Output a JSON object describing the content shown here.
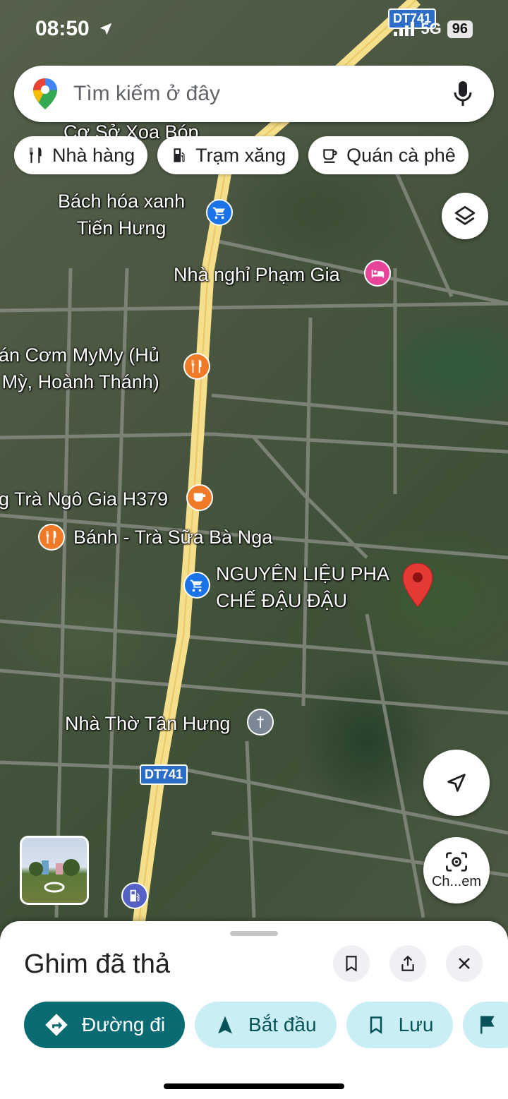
{
  "status_bar": {
    "time": "08:50",
    "network": "5G",
    "battery": "96"
  },
  "search": {
    "placeholder": "Tìm kiếm ở đây"
  },
  "chips": [
    {
      "label": "Nhà hàng",
      "icon": "restaurant-icon"
    },
    {
      "label": "Trạm xăng",
      "icon": "gas-station-icon"
    },
    {
      "label": "Quán cà phê",
      "icon": "coffee-icon"
    }
  ],
  "map": {
    "road_shields": [
      "DT741",
      "DT741"
    ],
    "places": [
      {
        "name": "Cơ Sở Xoa Bóp",
        "icon": "spa-icon"
      },
      {
        "name": "Bách hóa xanh\nTiến Hưng",
        "icon": "shopping-cart-icon",
        "color": "#1a73e8"
      },
      {
        "name": "Nhà nghỉ Phạm Gia",
        "icon": "hotel-icon",
        "color": "#e8459a"
      },
      {
        "name": "án Cơm MyMy (Hủ\nMỳ, Hoành Thánh)",
        "icon": "restaurant-icon",
        "color": "#f07a27"
      },
      {
        "name": "g Trà Ngô Gia H379",
        "icon": "coffee-icon",
        "color": "#f07a27"
      },
      {
        "name": "Bánh - Trà Sữa Bà Nga",
        "icon": "restaurant-icon",
        "color": "#f07a27"
      },
      {
        "name": "NGUYÊN LIỆU PHA\nCHẾ ĐẬU ĐẬU",
        "icon": "shopping-cart-icon",
        "color": "#1a73e8"
      },
      {
        "name": "Nhà Thờ Tân Hưng",
        "icon": "church-icon",
        "color": "#7b8794"
      }
    ],
    "dropped_pin_color": "#e53935"
  },
  "lens_button": {
    "label": "Ch...em"
  },
  "sheet": {
    "title": "Ghim đã thả",
    "actions": [
      {
        "label": "Đường đi"
      },
      {
        "label": "Bắt đầu"
      },
      {
        "label": "Lưu"
      }
    ]
  }
}
